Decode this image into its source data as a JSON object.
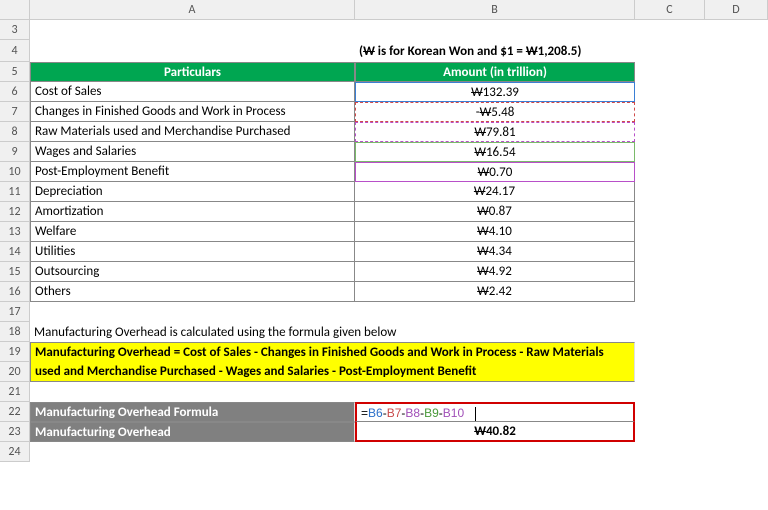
{
  "col_headers": {
    "A": "A",
    "B": "B",
    "C": "C",
    "D": "D"
  },
  "row_headers": [
    "3",
    "4",
    "5",
    "6",
    "7",
    "8",
    "9",
    "10",
    "11",
    "12",
    "13",
    "14",
    "15",
    "16",
    "17",
    "18",
    "19",
    "20",
    "21",
    "22",
    "23",
    "24"
  ],
  "note": "(₩ is for Korean Won and $1 = ₩1,208.5)",
  "table": {
    "head_a": "Particulars",
    "head_b": "Amount (in trillion)",
    "rows": [
      {
        "label": "Cost of Sales",
        "value": "₩132.39"
      },
      {
        "label": "Changes in Finished Goods and Work in Process",
        "value": "₩5.48"
      },
      {
        "label": "Raw Materials used and Merchandise Purchased",
        "value": "₩79.81"
      },
      {
        "label": "Wages and Salaries",
        "value": "₩16.54"
      },
      {
        "label": "Post-Employment Benefit",
        "value": "₩0.70"
      },
      {
        "label": "Depreciation",
        "value": "₩24.17"
      },
      {
        "label": "Amortization",
        "value": "₩0.87"
      },
      {
        "label": "Welfare",
        "value": "₩4.10"
      },
      {
        "label": "Utilities",
        "value": "₩4.34"
      },
      {
        "label": "Outsourcing",
        "value": "₩4.92"
      },
      {
        "label": "Others",
        "value": "₩2.42"
      }
    ]
  },
  "explain": "Manufacturing Overhead is calculated using the formula given below",
  "formula_text": "Manufacturing Overhead = Cost of Sales - Changes in Finished Goods and Work in Process - Raw Materials used and Merchandise Purchased - Wages and Salaries - Post-Employment Benefit",
  "result": {
    "label_formula": "Manufacturing Overhead Formula",
    "label_value": "Manufacturing Overhead",
    "formula_parts": {
      "eq": "=",
      "r1": "B6",
      "r2": "B7",
      "r3": "B8",
      "r4": "B9",
      "r5": "B10",
      "minus": "-"
    },
    "value": "₩40.82"
  },
  "chart_data": {
    "type": "table",
    "title": "Amount (in trillion) – Korean Won",
    "categories": [
      "Cost of Sales",
      "Changes in Finished Goods and Work in Process",
      "Raw Materials used and Merchandise Purchased",
      "Wages and Salaries",
      "Post-Employment Benefit",
      "Depreciation",
      "Amortization",
      "Welfare",
      "Utilities",
      "Outsourcing",
      "Others"
    ],
    "values": [
      132.39,
      -5.48,
      79.81,
      16.54,
      0.7,
      24.17,
      0.87,
      4.1,
      4.34,
      4.92,
      2.42
    ],
    "derived": {
      "Manufacturing Overhead": 40.82
    },
    "unit": "trillion KRW",
    "fx_note": "$1 = ₩1,208.5"
  }
}
